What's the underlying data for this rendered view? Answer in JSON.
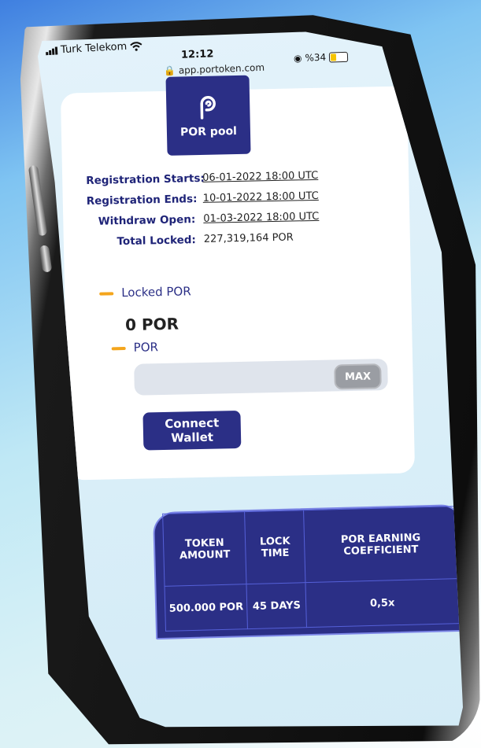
{
  "status_bar": {
    "carrier": "Turk Telekom",
    "time": "12:12",
    "url": "app.portoken.com",
    "battery": "%34"
  },
  "pool": {
    "logo_title": "POR pool",
    "rows": [
      {
        "label": "Registration Starts:",
        "value": "06-01-2022 18:00 UTC"
      },
      {
        "label": "Registration Ends:",
        "value": "10-01-2022 18:00 UTC"
      },
      {
        "label": "Withdraw Open:",
        "value": "01-03-2022 18:00 UTC"
      },
      {
        "label": "Total Locked:",
        "value": "227,319,164 POR"
      }
    ],
    "locked_label": "Locked POR",
    "locked_value": "0 POR",
    "input_label": "POR",
    "input_value": "",
    "max_label": "MAX",
    "connect_label": "Connect Wallet"
  },
  "table": {
    "headers": [
      "TOKEN AMOUNT",
      "LOCK TIME",
      "POR EARNING COEFFICIENT"
    ],
    "row": [
      "500.000 POR",
      "45 DAYS",
      "0,5x"
    ]
  },
  "colors": {
    "brand": "#2b2f86",
    "accent": "#f4a51c",
    "max_button": "#9a9da3"
  }
}
